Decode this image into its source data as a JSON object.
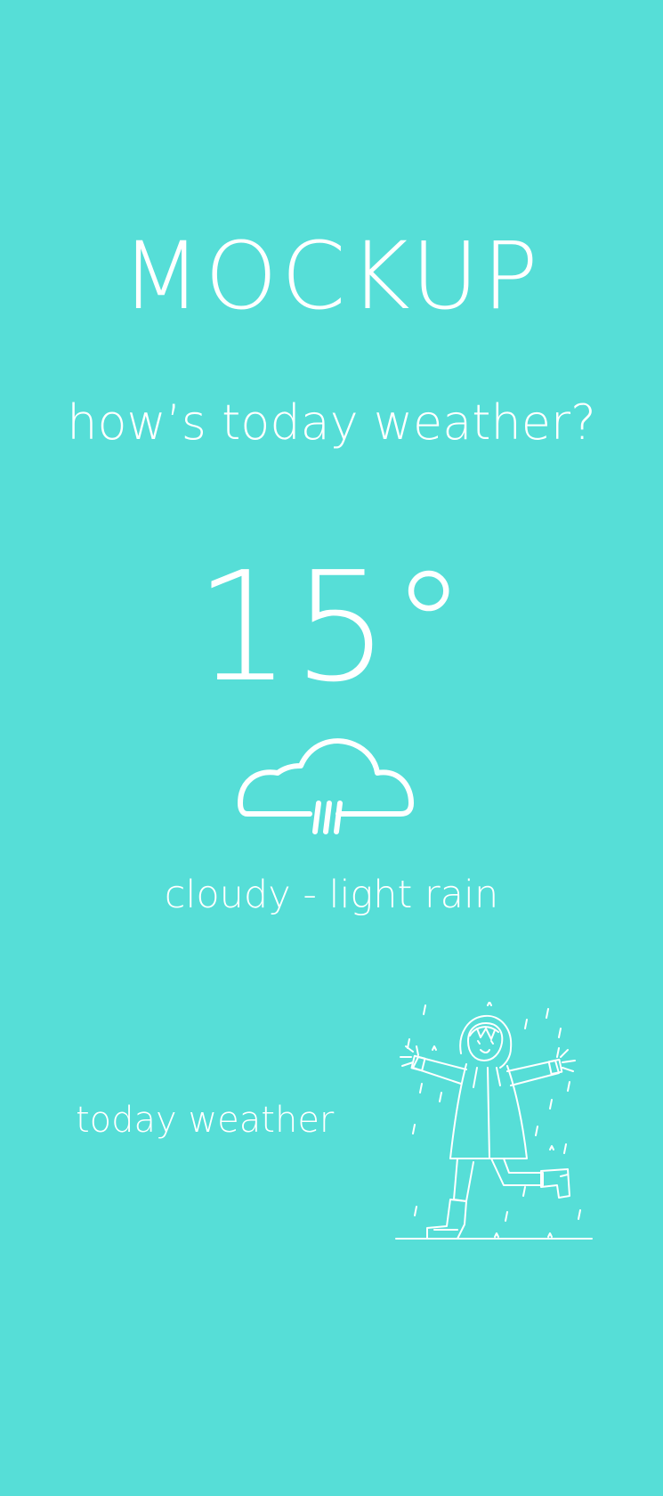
{
  "app": {
    "title": "MOCKUP",
    "subtitle": "how’s today weather?"
  },
  "weather": {
    "temperature": "15°",
    "condition": "cloudy - light rain",
    "condition_icon": "cloud-rain-icon"
  },
  "footer": {
    "label": "today weather",
    "illustration": "child-in-raincoat-illustration"
  },
  "colors": {
    "background": "#56ded7",
    "foreground": "#ffffff"
  }
}
